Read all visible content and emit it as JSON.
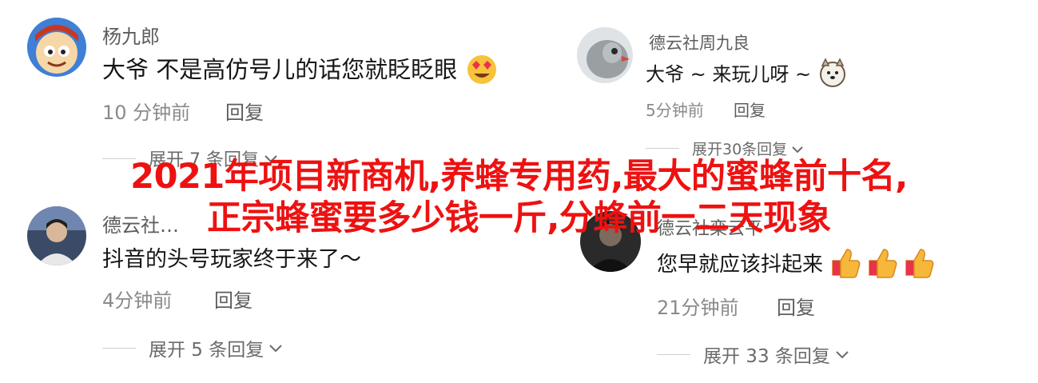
{
  "overlay": {
    "title": "2021年项目新商机,养蜂专用药,最大的蜜蜂前十名,正宗蜂蜜要多少钱一斤,分蜂前一二天现象"
  },
  "comments": [
    {
      "name": "杨九郎",
      "text": "大爷 不是高仿号儿的话您就眨眨眼",
      "emoji": "heart-eyes-emoji",
      "time": "10 分钟前",
      "reply": "回复",
      "expand": "展开 7 条回复"
    },
    {
      "name": "德云社周九良",
      "text": "大爷 ~ 来玩儿呀 ~",
      "emoji": "dog-emoji",
      "time": "5分钟前",
      "reply": "回复",
      "expand": "展开30条回复"
    },
    {
      "name": "德云社…",
      "text": "抖音的头号玩家终于来了～",
      "time": "4分钟前",
      "reply": "回复",
      "expand": "展开 5 条回复"
    },
    {
      "name": "德云社栾云平",
      "text": "您早就应该抖起来",
      "emoji": "thumbs-up-emoji",
      "time": "21分钟前",
      "reply": "回复",
      "expand": "展开 33 条回复"
    }
  ]
}
